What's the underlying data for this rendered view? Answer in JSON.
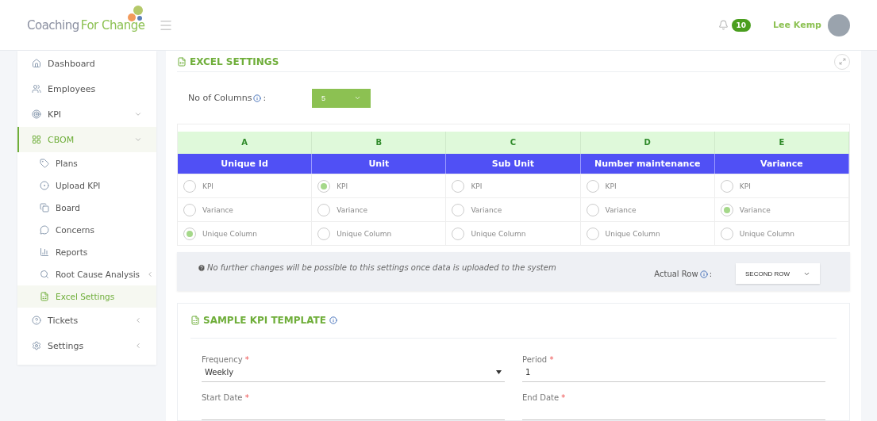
{
  "header": {
    "logo_main": "Coaching",
    "logo_accent": "For Change",
    "notifications": "10",
    "user_name": "Lee Kemp"
  },
  "sidebar": {
    "items": [
      {
        "label": "Dashboard",
        "selected": false
      },
      {
        "label": "Employees",
        "selected": false
      },
      {
        "label": "KPI",
        "selected": false
      },
      {
        "label": "CBOM",
        "selected": true,
        "expanded": true,
        "children": [
          {
            "label": "Plans",
            "selected": false
          },
          {
            "label": "Upload KPI",
            "selected": false
          },
          {
            "label": "Board",
            "selected": false
          },
          {
            "label": "Concerns",
            "selected": false
          },
          {
            "label": "Reports",
            "selected": false
          },
          {
            "label": "Root Cause Analysis",
            "selected": false
          },
          {
            "label": "Excel Settings",
            "selected": true
          }
        ]
      },
      {
        "label": "Tickets",
        "selected": false
      },
      {
        "label": "Settings",
        "selected": false
      }
    ]
  },
  "excel_settings": {
    "title": "EXCEL SETTINGS",
    "columns_label": "No of Columns",
    "columns_colon": ":",
    "columns_value": "5",
    "table": {
      "columns": [
        {
          "letter": "A",
          "header": "Unique Id",
          "options": [
            {
              "label": "KPI",
              "selected": false
            },
            {
              "label": "Variance",
              "selected": false
            },
            {
              "label": "Unique Column",
              "selected": true
            }
          ]
        },
        {
          "letter": "B",
          "header": "Unit",
          "options": [
            {
              "label": "KPI",
              "selected": true
            },
            {
              "label": "Variance",
              "selected": false
            },
            {
              "label": "Unique Column",
              "selected": false
            }
          ]
        },
        {
          "letter": "C",
          "header": "Sub Unit",
          "options": [
            {
              "label": "KPI",
              "selected": false
            },
            {
              "label": "Variance",
              "selected": false
            },
            {
              "label": "Unique Column",
              "selected": false
            }
          ]
        },
        {
          "letter": "D",
          "header": "Number maintenance",
          "options": [
            {
              "label": "KPI",
              "selected": false
            },
            {
              "label": "Variance",
              "selected": false
            },
            {
              "label": "Unique Column",
              "selected": false
            }
          ]
        },
        {
          "letter": "E",
          "header": "Variance",
          "options": [
            {
              "label": "KPI",
              "selected": false
            },
            {
              "label": "Variance",
              "selected": true
            },
            {
              "label": "Unique Column",
              "selected": false
            }
          ]
        }
      ]
    },
    "note": "No further changes will be possible to this settings once data is uploaded to the system",
    "actual_row_label": "Actual Row",
    "actual_row_colon": ":",
    "actual_row_value": "SECOND ROW"
  },
  "sample_template": {
    "title": "SAMPLE KPI TEMPLATE",
    "fields": [
      {
        "label": "Frequency",
        "required_mark": "*",
        "kind": "select",
        "value": "Weekly"
      },
      {
        "label": "Period",
        "required_mark": "*",
        "kind": "text",
        "value": "1"
      },
      {
        "label": "Start Date",
        "required_mark": "*",
        "kind": "text"
      },
      {
        "label": "End Date",
        "required_mark": "*",
        "kind": "text"
      }
    ]
  }
}
